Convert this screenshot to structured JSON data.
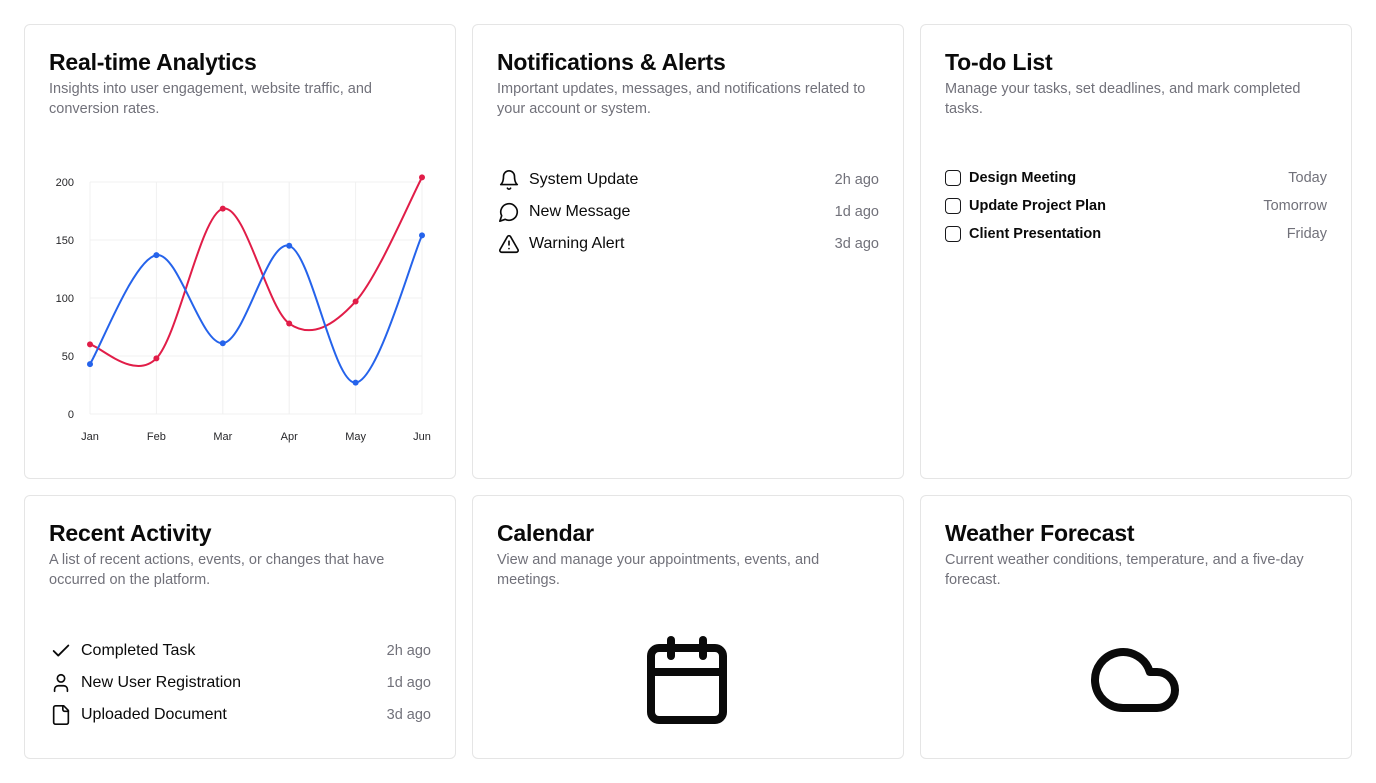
{
  "analytics": {
    "title": "Real-time Analytics",
    "description": "Insights into user engagement, website traffic, and conversion rates."
  },
  "notifications": {
    "title": "Notifications & Alerts",
    "description": "Important updates, messages, and notifications related to your account or system.",
    "items": [
      {
        "label": "System Update",
        "time": "2h ago",
        "icon": "bell-icon"
      },
      {
        "label": "New Message",
        "time": "1d ago",
        "icon": "message-circle-icon"
      },
      {
        "label": "Warning Alert",
        "time": "3d ago",
        "icon": "alert-triangle-icon"
      }
    ]
  },
  "todo": {
    "title": "To-do List",
    "description": "Manage your tasks, set deadlines, and mark completed tasks.",
    "items": [
      {
        "label": "Design Meeting",
        "due": "Today",
        "checked": false
      },
      {
        "label": "Update Project Plan",
        "due": "Tomorrow",
        "checked": false
      },
      {
        "label": "Client Presentation",
        "due": "Friday",
        "checked": false
      }
    ]
  },
  "activity": {
    "title": "Recent Activity",
    "description": "A list of recent actions, events, or changes that have occurred on the platform.",
    "items": [
      {
        "label": "Completed Task",
        "time": "2h ago",
        "icon": "check-icon"
      },
      {
        "label": "New User Registration",
        "time": "1d ago",
        "icon": "user-icon"
      },
      {
        "label": "Uploaded Document",
        "time": "3d ago",
        "icon": "file-icon"
      }
    ]
  },
  "calendar": {
    "title": "Calendar",
    "description": "View and manage your appointments, events, and meetings.",
    "icon": "calendar-icon"
  },
  "weather": {
    "title": "Weather Forecast",
    "description": "Current weather conditions, temperature, and a five-day forecast.",
    "icon": "cloud-icon"
  },
  "chart_data": {
    "type": "line",
    "categories": [
      "Jan",
      "Feb",
      "Mar",
      "Apr",
      "May",
      "Jun"
    ],
    "series": [
      {
        "values": [
          60,
          48,
          177,
          78,
          97,
          204
        ],
        "color": "#e11d48"
      },
      {
        "values": [
          43,
          137,
          61,
          145,
          27,
          154
        ],
        "color": "#2563eb"
      }
    ],
    "ylim": [
      0,
      200
    ],
    "yticks": [
      0,
      50,
      100,
      150,
      200
    ],
    "grid": true,
    "smooth": true
  }
}
